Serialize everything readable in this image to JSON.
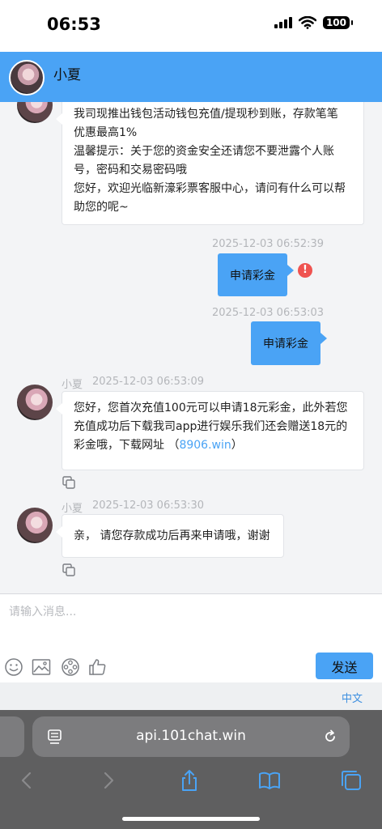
{
  "status_bar": {
    "time": "06:53",
    "battery": "100"
  },
  "header": {
    "name": "小夏"
  },
  "messages": [
    {
      "side": "left",
      "lines": [
        "我司现推出钱包活动钱包充值/提现秒到账，存款笔笔",
        "优惠最高1%",
        "温馨提示：关于您的资金安全还请您不要泄露个人账",
        "号，密码和交易密码哦",
        "您好，欢迎光临新濠彩票客服中心，请问有什么可以帮",
        "助您的呢~"
      ]
    },
    {
      "side": "right",
      "timestamp": "2025-12-03 06:52:39",
      "text": "申请彩金",
      "status": "failed",
      "status_icon": "!"
    },
    {
      "side": "right",
      "timestamp": "2025-12-03 06:53:03",
      "text": "申请彩金"
    },
    {
      "side": "left",
      "sender": "小夏",
      "timestamp": "2025-12-03 06:53:09",
      "lines": [
        "您好，您首次充值100元可以申请18元彩金，此外若您",
        "充值成功后下载我司app进行娱乐我们还会赠送18元的"
      ],
      "line3_prefix": "彩金哦，下载网址  （",
      "link": "8906.win",
      "line3_suffix": "）"
    },
    {
      "side": "left",
      "sender": "小夏",
      "timestamp": "2025-12-03 06:53:30",
      "text": "亲，  请您存款成功后再来申请哦，谢谢"
    }
  ],
  "input": {
    "placeholder": "请输入消息...",
    "send_label": "发送"
  },
  "language": {
    "label": "中文"
  },
  "browser": {
    "url": "api.101chat.win"
  },
  "colors": {
    "accent": "#4aa3f5",
    "error": "#ef5350",
    "background": "#f3f4f6"
  }
}
